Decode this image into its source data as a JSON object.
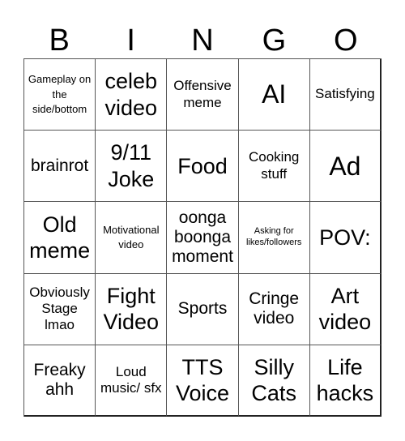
{
  "header": {
    "letters": [
      "B",
      "I",
      "N",
      "G",
      "O"
    ]
  },
  "board": {
    "cells": [
      "Gameplay on the side/bottom",
      "celeb video",
      "Offensive meme",
      "AI",
      "Satisfying",
      "brainrot",
      "9/11 Joke",
      "Food",
      "Cooking stuff",
      "Ad",
      "Old meme",
      "Motivational video",
      "oonga boonga moment",
      "Asking for likes/followers",
      "POV:",
      "Obviously Stage lmao",
      "Fight Video",
      "Sports",
      "Cringe video",
      "Art video",
      "Freaky ahh",
      "Loud music/ sfx",
      "TTS Voice",
      "Silly Cats",
      "Life hacks"
    ]
  }
}
